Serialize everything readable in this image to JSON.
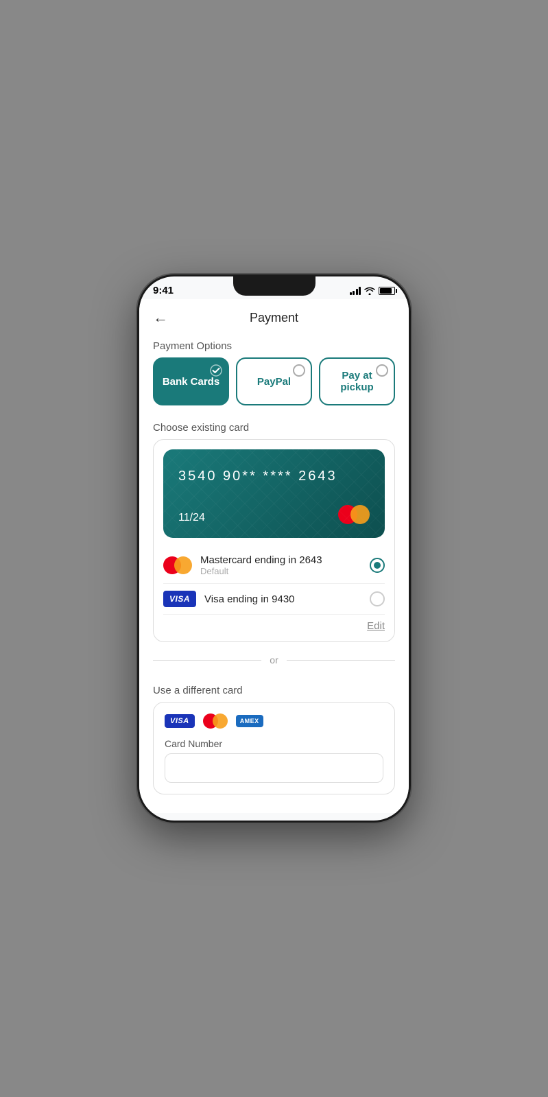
{
  "status": {
    "time": "9:41",
    "signal_alt": "signal",
    "wifi_alt": "wifi",
    "battery_alt": "battery"
  },
  "header": {
    "back_label": "←",
    "title": "Payment"
  },
  "payment_options_label": "Payment Options",
  "payment_options": [
    {
      "id": "bank_cards",
      "label": "Bank Cards",
      "active": true
    },
    {
      "id": "paypal",
      "label": "PayPal",
      "active": false
    },
    {
      "id": "pay_at_pickup",
      "label": "Pay at pickup",
      "active": false
    }
  ],
  "existing_card_section": {
    "label": "Choose existing card",
    "card": {
      "number": "3540  90**  ****  2643",
      "expiry": "11/24"
    },
    "cards": [
      {
        "brand": "mastercard",
        "name": "Mastercard ending in 2643",
        "sub": "Default",
        "selected": true
      },
      {
        "brand": "visa",
        "name": "Visa ending in 9430",
        "sub": "",
        "selected": false
      }
    ],
    "edit_label": "Edit"
  },
  "divider": {
    "or_label": "or"
  },
  "diff_card_section": {
    "label": "Use a different card",
    "accepted": [
      "VISA",
      "Mastercard",
      "AMEX"
    ],
    "card_number_label": "Card Number",
    "card_number_placeholder": ""
  }
}
